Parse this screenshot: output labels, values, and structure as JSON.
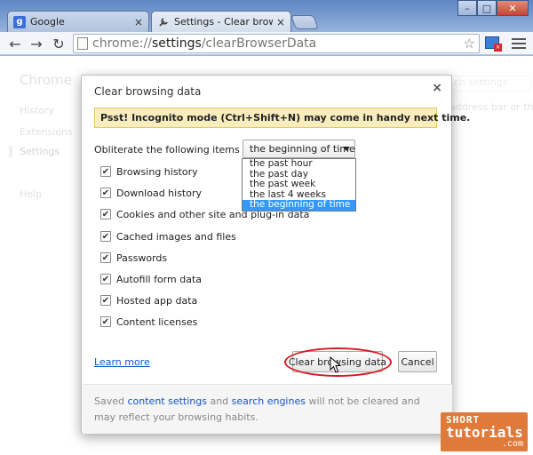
{
  "browser": {
    "tabs": [
      {
        "title": "Google",
        "icon": "google-favicon",
        "active": false
      },
      {
        "title": "Settings - Clear browsing da",
        "icon": "wrench-icon",
        "active": true
      }
    ],
    "address": {
      "prefix": "chrome://",
      "bold": "settings",
      "suffix": "/clearBrowserData"
    }
  },
  "page": {
    "nav_title": "Chrome",
    "nav_items": [
      "History",
      "Extensions",
      "Settings",
      "Help"
    ],
    "search_placeholder": "ch settings",
    "right_text": "address bar or the a"
  },
  "dialog": {
    "title": "Clear browsing data",
    "close": "×",
    "banner": "Psst! Incognito mode (Ctrl+Shift+N) may come in handy next time.",
    "obliterate_label": "Obliterate the following items from:",
    "selected_range": "the beginning of time",
    "range_options": [
      "the past hour",
      "the past day",
      "the past week",
      "the last 4 weeks",
      "the beginning of time"
    ],
    "checkboxes": [
      {
        "label": "Browsing history",
        "checked": true
      },
      {
        "label": "Download history",
        "checked": true
      },
      {
        "label": "Cookies and other site and plug-in data",
        "checked": true
      },
      {
        "label": "Cached images and files",
        "checked": true
      },
      {
        "label": "Passwords",
        "checked": true
      },
      {
        "label": "Autofill form data",
        "checked": true
      },
      {
        "label": "Hosted app data",
        "checked": true
      },
      {
        "label": "Content licenses",
        "checked": true
      }
    ],
    "learn_more": "Learn more",
    "clear_button": "Clear browsing data",
    "cancel_button": "Cancel",
    "footer": {
      "t1": "Saved ",
      "link1": "content settings",
      "t2": " and ",
      "link2": "search engines",
      "t3": " will not be cleared and may reflect your browsing habits."
    }
  },
  "watermark": {
    "line1": "SHORT",
    "line2": "tutorials",
    "line3": ".com"
  },
  "colors": {
    "selection": "#3399ff",
    "banner": "#f9edbe",
    "link": "#1155cc",
    "highlight_ring": "#d41b22"
  }
}
